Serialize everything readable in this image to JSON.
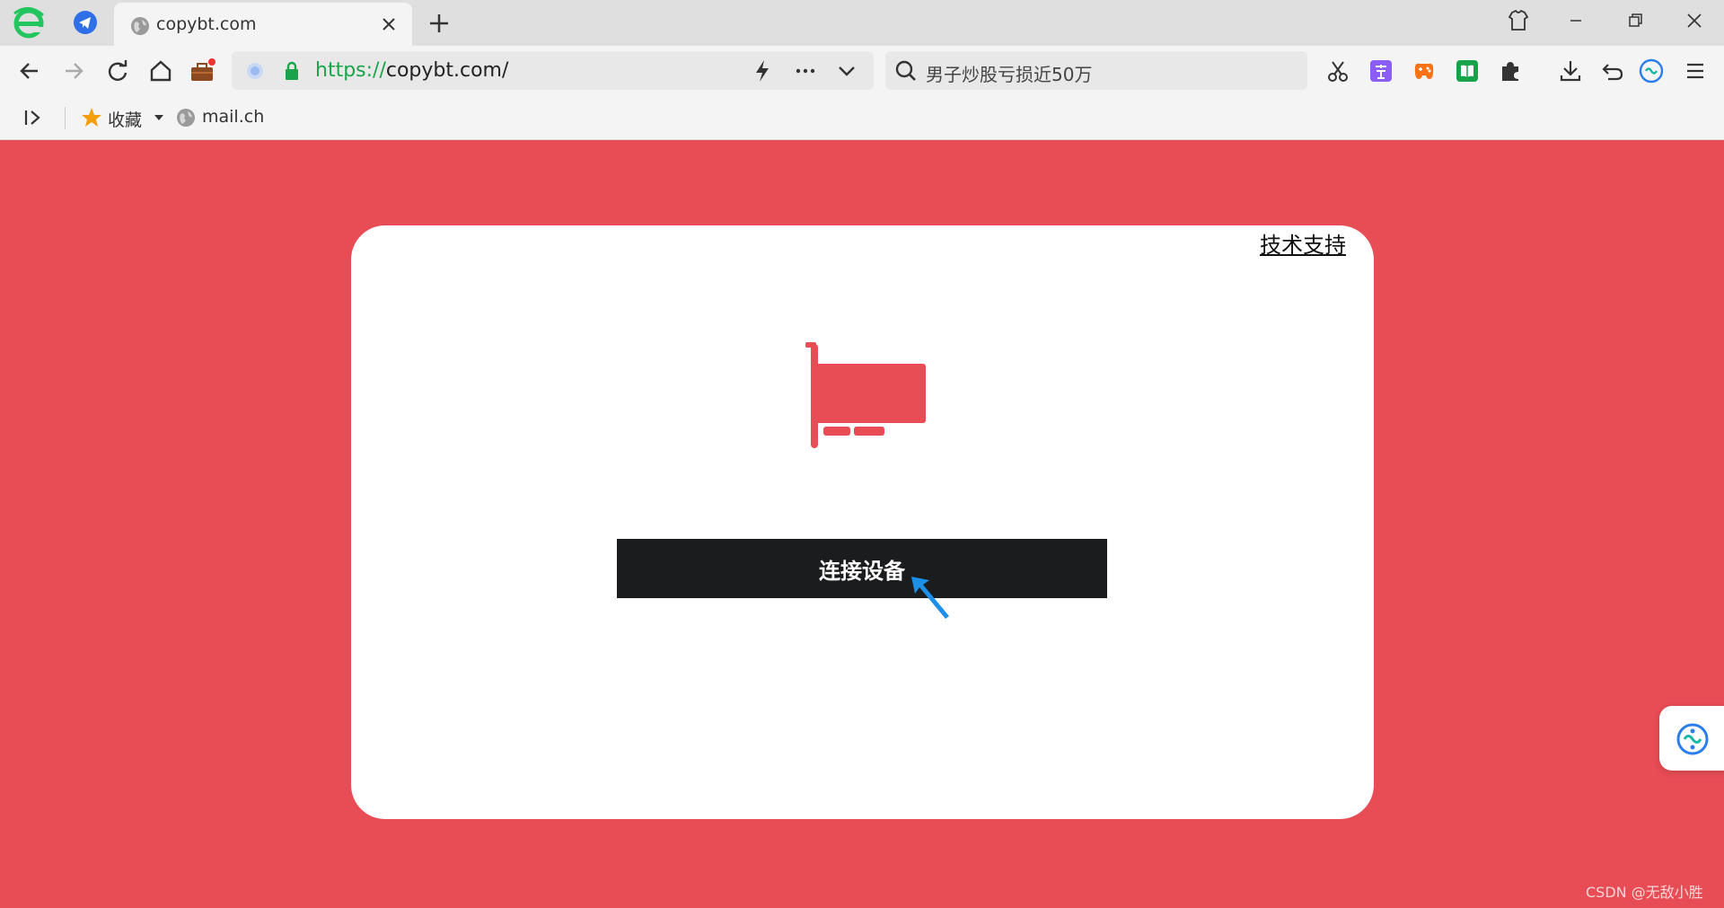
{
  "tabbar": {
    "tab_title": "copybt.com",
    "icons": {
      "browser_logo": "ie-style-logo",
      "pinned": "telegram-icon",
      "new_tab": "plus-icon"
    }
  },
  "toolbar": {
    "url_scheme": "https://",
    "url_rest": "copybt.com/",
    "search_query": "男子炒股亏损近50万"
  },
  "bookmarks": {
    "favorites_label": "收藏",
    "mail_label": "mail.ch"
  },
  "page": {
    "support_link": "技术支持",
    "connect_button": "连接设备",
    "watermark": "CSDN @无敌小胜",
    "colors": {
      "background": "#e84c55",
      "button": "#1b1c1e",
      "icon": "#e84c55",
      "card": "#ffffff"
    }
  }
}
